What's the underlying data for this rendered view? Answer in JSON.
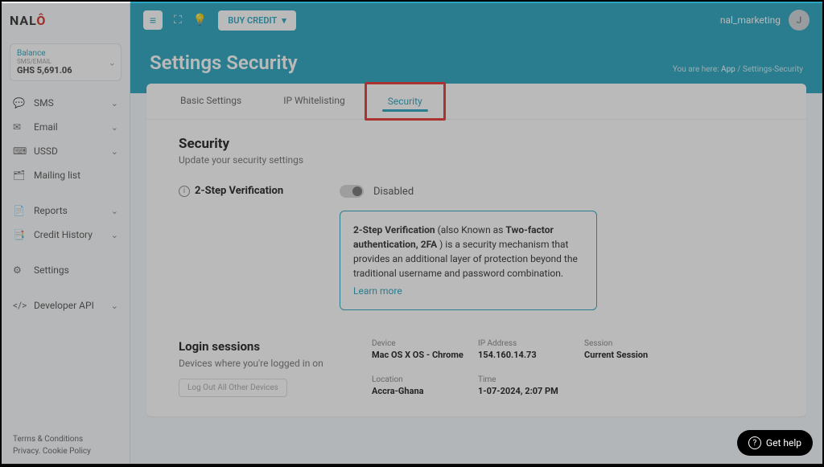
{
  "brand": {
    "name": "NALO"
  },
  "balance": {
    "label": "Balance",
    "sub": "SMS/EMAIL",
    "amount": "GHS 5,691.06"
  },
  "sidebar": {
    "items": [
      {
        "label": "SMS",
        "icon": "💬",
        "expandable": true
      },
      {
        "label": "Email",
        "icon": "✉",
        "expandable": true
      },
      {
        "label": "USSD",
        "icon": "⌨",
        "expandable": true
      },
      {
        "label": "Mailing list",
        "icon": "🗂",
        "expandable": false
      },
      {
        "label": "Reports",
        "icon": "📄",
        "expandable": true
      },
      {
        "label": "Credit History",
        "icon": "📑",
        "expandable": true
      },
      {
        "label": "Settings",
        "icon": "⚙",
        "expandable": false
      },
      {
        "label": "Developer API",
        "icon": "</>",
        "expandable": true
      }
    ]
  },
  "footer": {
    "line1": "Terms & Conditions",
    "line2": "Privacy. Cookie Policy"
  },
  "topbar": {
    "buy_credit": "BUY CREDIT",
    "user": "nal_marketing",
    "avatar_initial": "J"
  },
  "header": {
    "title": "Settings Security",
    "breadcrumb_prefix": "You are here:",
    "breadcrumb_app": "App",
    "breadcrumb_current": "Settings-Security"
  },
  "tabs": [
    {
      "label": "Basic Settings"
    },
    {
      "label": "IP Whitelisting"
    },
    {
      "label": "Security"
    }
  ],
  "security": {
    "title": "Security",
    "subtitle": "Update your security settings",
    "twofa_label": "2-Step Verification",
    "twofa_status": "Disabled",
    "info_bold1": "2-Step Verification",
    "info_mid": " (also Known as ",
    "info_bold2": "Two-factor authentication, 2FA",
    "info_rest": " ) is a security mechanism that provides an additional layer of protection beyond the traditional username and password combination.",
    "learn_more": "Learn more"
  },
  "sessions": {
    "title": "Login sessions",
    "subtitle": "Devices where you're logged in on",
    "logout_all": "Log Out All Other Devices",
    "device_label": "Device",
    "device_val": "Mac OS X OS - Chrome",
    "ip_label": "IP Address",
    "ip_val": "154.160.14.73",
    "session_label": "Session",
    "session_val": "Current Session",
    "location_label": "Location",
    "location_val": "Accra-Ghana",
    "time_label": "Time",
    "time_val": "1-07-2024, 2:07 PM"
  },
  "help": {
    "label": "Get help"
  }
}
